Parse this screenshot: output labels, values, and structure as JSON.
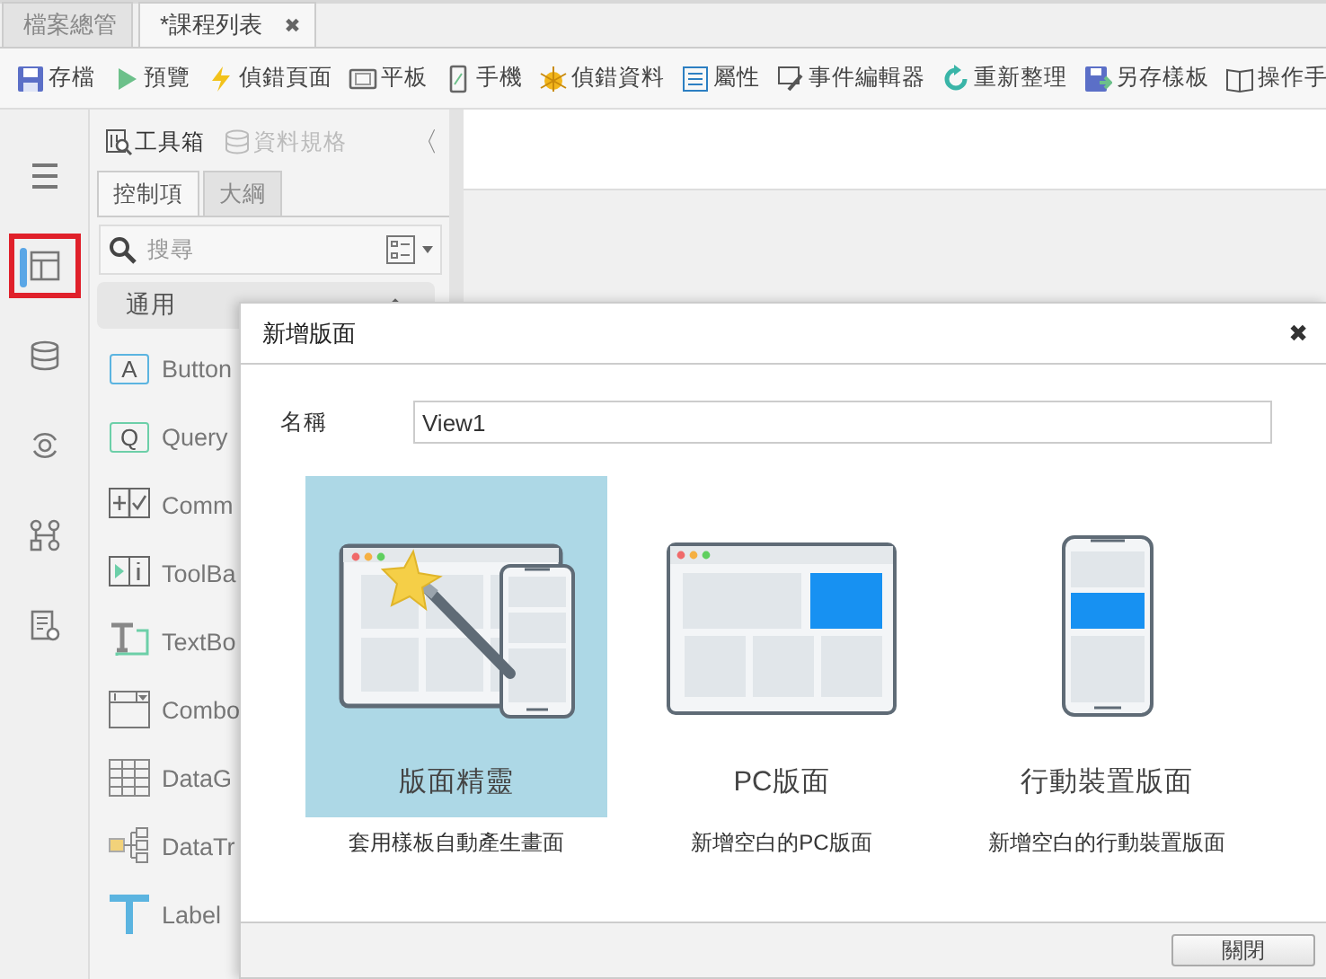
{
  "doc_tabs": [
    {
      "label": "檔案總管",
      "selected": false
    },
    {
      "label": "*課程列表",
      "selected": true,
      "close_glyph": "✖"
    }
  ],
  "toolbar": [
    {
      "kind": "save",
      "label": "存檔"
    },
    {
      "kind": "play",
      "label": "預覽"
    },
    {
      "kind": "bolt",
      "label": "偵錯頁面"
    },
    {
      "kind": "tablet",
      "label": "平板"
    },
    {
      "kind": "phone",
      "label": "手機"
    },
    {
      "kind": "bug",
      "label": "偵錯資料"
    },
    {
      "kind": "list",
      "label": "屬性"
    },
    {
      "kind": "edit",
      "label": "事件編輯器"
    },
    {
      "kind": "refresh",
      "label": "重新整理"
    },
    {
      "kind": "saveas",
      "label": "另存樣板"
    },
    {
      "kind": "book",
      "label": "操作手"
    }
  ],
  "rail": [
    {
      "kind": "menu",
      "selected": false
    },
    {
      "kind": "layout",
      "selected": true
    },
    {
      "kind": "database",
      "selected": false
    },
    {
      "kind": "sync",
      "selected": false
    },
    {
      "kind": "flow",
      "selected": false
    },
    {
      "kind": "form",
      "selected": false
    }
  ],
  "panel": {
    "header": [
      {
        "label": "工具箱",
        "disabled": false,
        "kind": "toolbox"
      },
      {
        "label": "資料規格",
        "disabled": true,
        "kind": "database"
      }
    ],
    "collapse_glyph": "〈",
    "tabs": [
      {
        "label": "控制項",
        "selected": true
      },
      {
        "label": "大綱",
        "selected": false
      }
    ],
    "search": {
      "placeholder": "搜尋"
    },
    "group": {
      "label": "通用",
      "expanded": true
    },
    "items": [
      {
        "kind": "button",
        "label": "Button",
        "icon_glyph": "A"
      },
      {
        "kind": "query",
        "label": "Query",
        "icon_glyph": "Q"
      },
      {
        "kind": "command",
        "label": "Comm"
      },
      {
        "kind": "toolbar",
        "label": "ToolBa"
      },
      {
        "kind": "textbox",
        "label": "TextBo"
      },
      {
        "kind": "combo",
        "label": "Combo"
      },
      {
        "kind": "grid",
        "label": "DataG"
      },
      {
        "kind": "tree",
        "label": "DataTr"
      },
      {
        "kind": "label",
        "label": "Label"
      }
    ]
  },
  "dialog": {
    "title": "新增版面",
    "close_glyph": "✖",
    "name_label": "名稱",
    "name_value": "View1",
    "options": [
      {
        "kind": "wizard",
        "title": "版面精靈",
        "description": "套用樣板自動產生畫面",
        "selected": true
      },
      {
        "kind": "pc",
        "title": "PC版面",
        "description": "新增空白的PC版面",
        "selected": false
      },
      {
        "kind": "mobile",
        "title": "行動裝置版面",
        "description": "新增空白的行動裝置版面",
        "selected": false
      }
    ],
    "buttons": [
      "關閉"
    ]
  }
}
